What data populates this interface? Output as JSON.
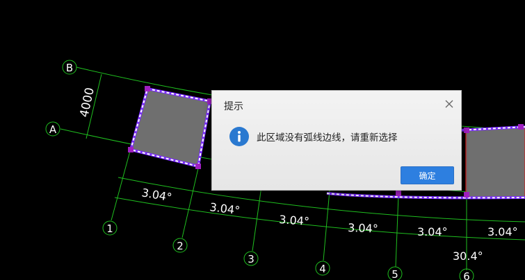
{
  "drawing": {
    "axis_labels": {
      "a": "A",
      "b": "B"
    },
    "grid_numbers": [
      "1",
      "2",
      "3",
      "4",
      "5",
      "6"
    ],
    "dimension_width": "4000",
    "angle_labels": [
      "3.04°",
      "3.04°",
      "3.04°",
      "3.04°",
      "3.04°",
      "3.04°"
    ],
    "total_angle": "30.4°",
    "colors": {
      "background": "#000000",
      "grid_line": "#1fbf1f",
      "slab_fill": "#6f6f6f",
      "slab_edge": "#d02020",
      "selection_dash": "#ffffff",
      "selection_outline": "#7b2cff",
      "grip": "#a020c0"
    }
  },
  "dialog": {
    "title": "提示",
    "message": "此区域没有弧线边线，请重新选择",
    "ok_label": "确定",
    "icon": "info-icon",
    "close_icon": "close-icon",
    "accent": "#2d7fe0"
  }
}
